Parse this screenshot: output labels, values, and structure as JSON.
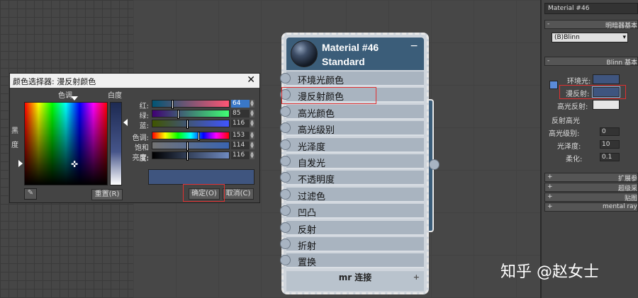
{
  "color_picker": {
    "title": "颜色选择器: 漫反射颜色",
    "close": "✕",
    "hue_label": "色调",
    "whiteness_label": "白度",
    "blackness_label_1": "黑",
    "blackness_label_2": "度",
    "reset_button": "重置(R)",
    "ok_button": "确定(O)",
    "cancel_button": "取消(C)",
    "sliders": [
      {
        "label": "红:",
        "value": "64",
        "fraction": 0.25
      },
      {
        "label": "绿:",
        "value": "85",
        "fraction": 0.33
      },
      {
        "label": "蓝:",
        "value": "116",
        "fraction": 0.45
      },
      {
        "label": "色调:",
        "value": "153",
        "fraction": 0.6
      },
      {
        "label": "饱和度:",
        "value": "114",
        "fraction": 0.45
      },
      {
        "label": "亮度:",
        "value": "116",
        "fraction": 0.45
      }
    ],
    "current_color": "#3f557f"
  },
  "node": {
    "title": "Material #46",
    "subtitle": "Standard",
    "minimize": "−",
    "slots": [
      "环境光颜色",
      "漫反射颜色",
      "高光颜色",
      "高光级别",
      "光泽度",
      "自发光",
      "不透明度",
      "过滤色",
      "凹凸",
      "反射",
      "折射",
      "置换"
    ],
    "mr_connect": "mr 连接",
    "mr_plus": "+"
  },
  "right_panel": {
    "material_name": "Material #46",
    "rollout_shader": "明暗器基本",
    "shader_type": "(B)Blinn",
    "rollout_blinn": "Blinn 基本",
    "ambient_label": "环境光:",
    "diffuse_label": "漫反射:",
    "specular_label": "高光反射:",
    "specular_highlights": "反射高光",
    "spec_level_label": "高光级别:",
    "spec_level_value": "0",
    "glossiness_label": "光泽度:",
    "glossiness_value": "10",
    "soften_label": "柔化:",
    "soften_value": "0.1",
    "rollouts": [
      "扩展参",
      "超级采",
      "贴图",
      "mental ray"
    ]
  },
  "watermark": "知乎 @赵女士",
  "colors": {
    "highlight_red": "#e03030",
    "node_header": "#3b5d79"
  }
}
